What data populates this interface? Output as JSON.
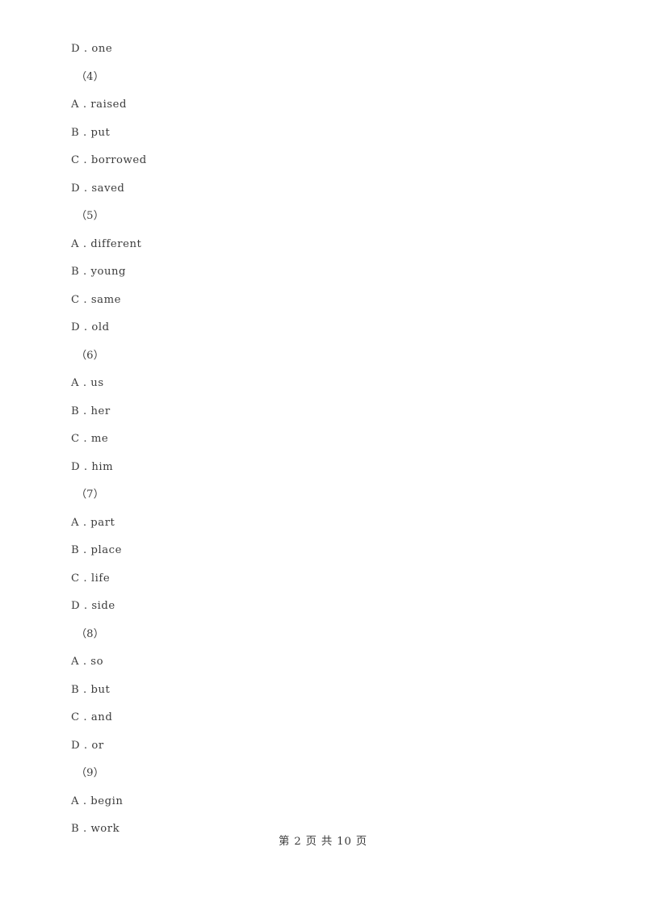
{
  "document": {
    "type": "exam-answer-options-page",
    "background_color": "#ffffff",
    "text_color": "#3c3c3c"
  },
  "body_lines": [
    {
      "kind": "option",
      "text": "D . one"
    },
    {
      "kind": "qnum",
      "text": "（4）"
    },
    {
      "kind": "option",
      "text": "A . raised"
    },
    {
      "kind": "option",
      "text": "B . put"
    },
    {
      "kind": "option",
      "text": "C . borrowed"
    },
    {
      "kind": "option",
      "text": "D . saved"
    },
    {
      "kind": "qnum",
      "text": "（5）"
    },
    {
      "kind": "option",
      "text": "A . different"
    },
    {
      "kind": "option",
      "text": "B . young"
    },
    {
      "kind": "option",
      "text": "C . same"
    },
    {
      "kind": "option",
      "text": "D . old"
    },
    {
      "kind": "qnum",
      "text": "（6）"
    },
    {
      "kind": "option",
      "text": "A . us"
    },
    {
      "kind": "option",
      "text": "B . her"
    },
    {
      "kind": "option",
      "text": "C . me"
    },
    {
      "kind": "option",
      "text": "D . him"
    },
    {
      "kind": "qnum",
      "text": "（7）"
    },
    {
      "kind": "option",
      "text": "A . part"
    },
    {
      "kind": "option",
      "text": "B . place"
    },
    {
      "kind": "option",
      "text": "C . life"
    },
    {
      "kind": "option",
      "text": "D . side"
    },
    {
      "kind": "qnum",
      "text": "（8）"
    },
    {
      "kind": "option",
      "text": "A . so"
    },
    {
      "kind": "option",
      "text": "B . but"
    },
    {
      "kind": "option",
      "text": "C . and"
    },
    {
      "kind": "option",
      "text": "D . or"
    },
    {
      "kind": "qnum",
      "text": "（9）"
    },
    {
      "kind": "option",
      "text": "A . begin"
    },
    {
      "kind": "option",
      "text": "B . work"
    }
  ],
  "footer": {
    "text": "第 2 页 共 10 页",
    "current_page": "2",
    "total_pages": "10"
  }
}
